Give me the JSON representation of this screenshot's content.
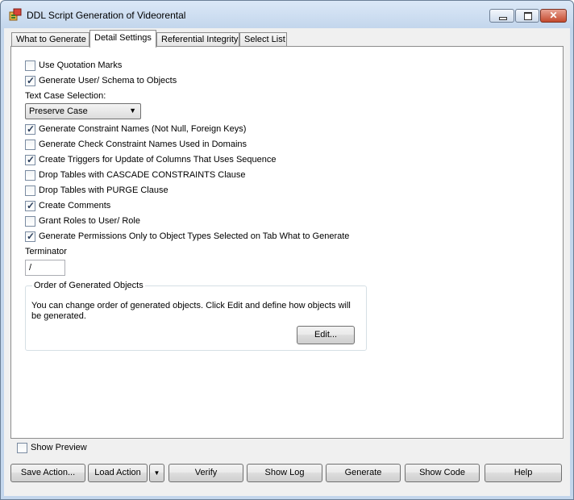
{
  "window": {
    "title": "DDL Script Generation of Videorental",
    "minimize_glyph": "",
    "maximize_glyph": "",
    "close_glyph": "✕"
  },
  "tabs": [
    {
      "label": "What to Generate",
      "active": false
    },
    {
      "label": "Detail Settings",
      "active": true
    },
    {
      "label": "Referential Integrity",
      "active": false
    },
    {
      "label": "Select List",
      "active": false
    }
  ],
  "detail": {
    "use_quotation_marks": {
      "label": "Use Quotation Marks",
      "checked": false
    },
    "generate_user_schema": {
      "label": "Generate User/ Schema to Objects",
      "checked": true
    },
    "text_case_label": "Text Case Selection:",
    "text_case_value": "Preserve Case",
    "options": [
      {
        "label": "Generate Constraint Names (Not Null, Foreign Keys)",
        "checked": true
      },
      {
        "label": "Generate Check Constraint Names Used in Domains",
        "checked": false
      },
      {
        "label": "Create Triggers for Update of Columns That Uses Sequence",
        "checked": true
      },
      {
        "label": "Drop Tables with CASCADE CONSTRAINTS Clause",
        "checked": false
      },
      {
        "label": "Drop Tables with PURGE Clause",
        "checked": false
      },
      {
        "label": "Create Comments",
        "checked": true
      },
      {
        "label": "Grant Roles to User/ Role",
        "checked": false
      },
      {
        "label": "Generate Permissions Only to Object Types Selected on Tab What to Generate",
        "checked": true
      }
    ],
    "terminator_label": "Terminator",
    "terminator_value": "/",
    "order_group": {
      "title": "Order of Generated Objects",
      "text": "You can change order of generated objects. Click Edit and define how objects will be generated.",
      "edit_label": "Edit..."
    }
  },
  "show_preview": {
    "label": "Show Preview",
    "checked": false
  },
  "buttons": {
    "save_action": "Save Action...",
    "load_action": "Load Action",
    "load_dropdown": "▼",
    "verify": "Verify",
    "show_log": "Show Log",
    "generate": "Generate",
    "show_code": "Show Code",
    "help": "Help"
  },
  "check_glyph": "✓"
}
